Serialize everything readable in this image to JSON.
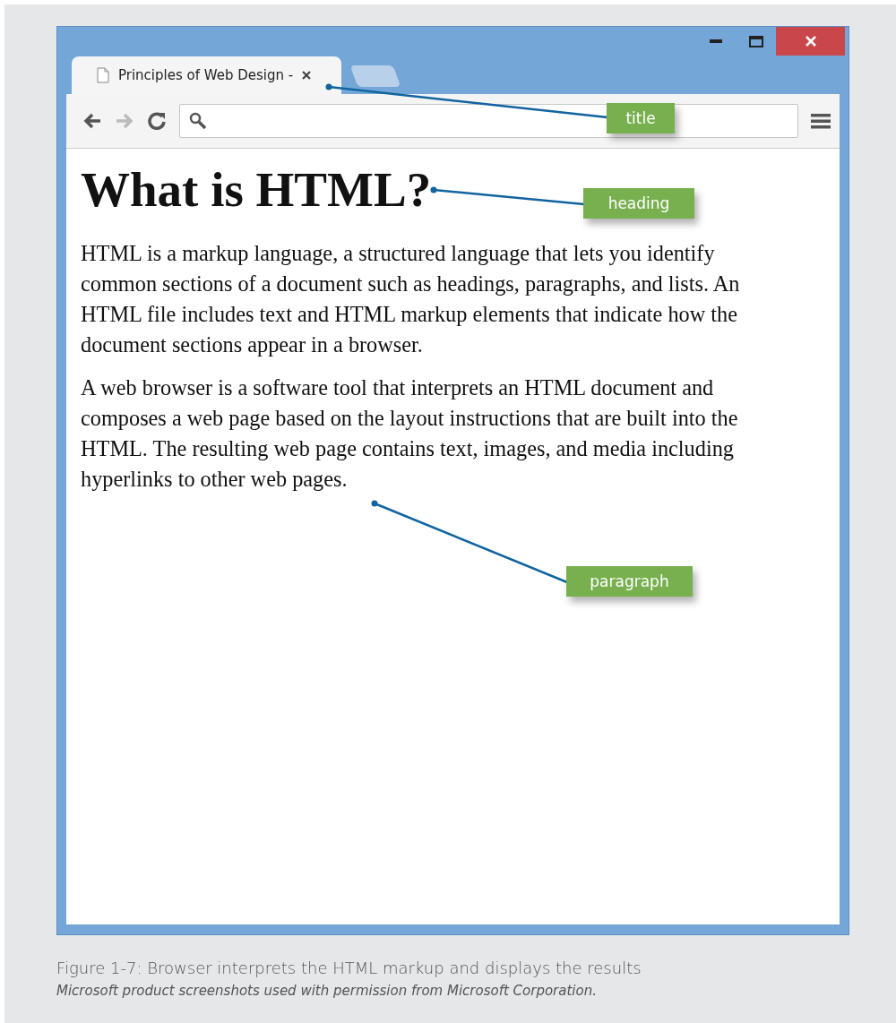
{
  "browser": {
    "tabs": [
      {
        "title": "Principles of Web Design -",
        "selected": true
      }
    ],
    "page": {
      "heading": "What is HTML?",
      "paragraphs": [
        "HTML is a markup language, a structured language that lets you identify common sections of a document such as headings, paragraphs, and lists. An HTML file includes text and HTML markup elements that indicate how the document sections appear in a browser.",
        "A web browser is a software tool that interprets an HTML document and composes a web page based on the layout instructions that are built into the HTML. The resulting web page contains text, images, and media including hyperlinks to other web pages."
      ]
    }
  },
  "callouts": [
    {
      "label": "title"
    },
    {
      "label": "heading"
    },
    {
      "label": "paragraph"
    }
  ],
  "caption": "Figure 1-7: Browser interprets the HTML markup and displays the results",
  "credit": "Microsoft product screenshots used with permission from Microsoft Corporation."
}
